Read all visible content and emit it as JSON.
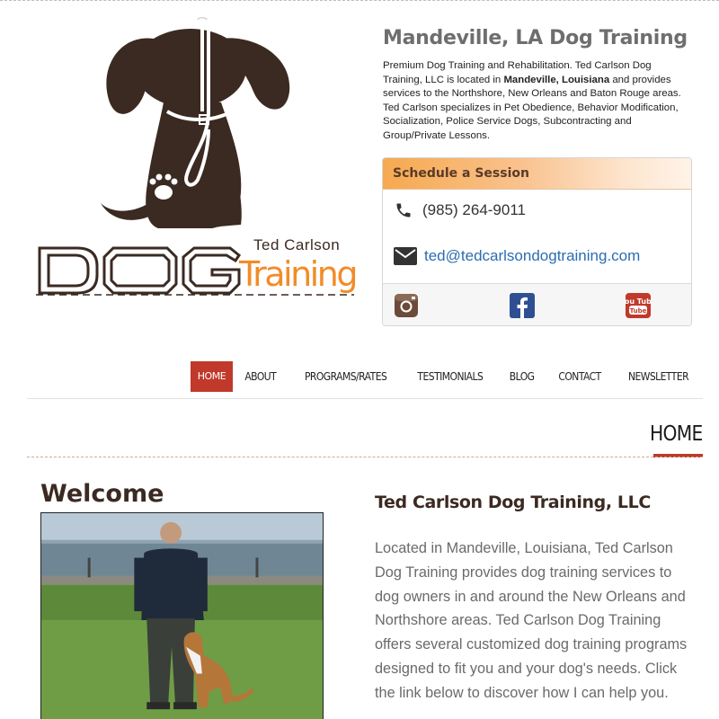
{
  "logo": {
    "dog_text": "DOG",
    "ted_carlson_text": "Ted Carlson",
    "training_text": "Training",
    "colors": {
      "brown": "#3b2a22",
      "orange": "#f28c28"
    }
  },
  "intro": {
    "title": "Mandeville, LA Dog Training",
    "text_1": "Premium Dog Training and Rehabilitation. Ted Carlson Dog Training, LLC is located in ",
    "text_bold": "Mandeville, Louisiana",
    "text_2": " and provides services to the Northshore, New Orleans and Baton Rouge areas. Ted Carlson specializes in Pet Obedience, Behavior Modification, Socialization, Police Service Dogs, Subcontracting and Group/Private Lessons."
  },
  "schedule": {
    "heading": "Schedule a Session",
    "phone": "(985) 264-9011",
    "email": "ted@tedcarlsondogtraining.com",
    "social": [
      {
        "name": "instagram",
        "icon": "instagram-icon"
      },
      {
        "name": "facebook",
        "icon": "facebook-icon"
      },
      {
        "name": "youtube",
        "icon": "youtube-icon",
        "label": "You Tube"
      }
    ]
  },
  "nav": {
    "items": [
      "HOME",
      "ABOUT",
      "PROGRAMS/RATES",
      "TESTIMONIALS",
      "BLOG",
      "CONTACT",
      "NEWSLETTER"
    ],
    "active": "HOME",
    "active_color": "#c0392b"
  },
  "page": {
    "heading": "HOME"
  },
  "welcome": {
    "title": "Welcome",
    "company_title": "Ted Carlson Dog Training, LLC",
    "body": "Located in Mandeville, Louisiana, Ted Carlson Dog Training provides dog training services to dog owners in and around the New Orleans and Northshore areas. Ted Carlson Dog Training offers several customized dog training programs designed to fit you and your dog's needs. Click the link below to discover how I can help you."
  }
}
